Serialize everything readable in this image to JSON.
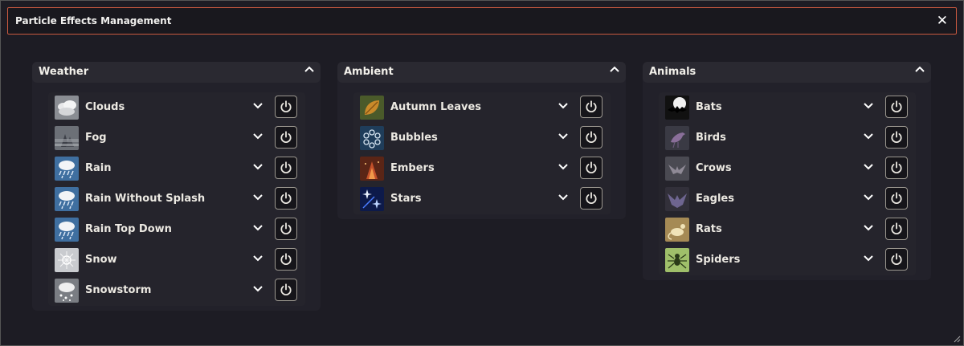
{
  "window": {
    "title": "Particle Effects Management",
    "close_glyph": "✕"
  },
  "panels": [
    {
      "title": "Weather",
      "items": [
        {
          "label": "Clouds",
          "icon": "cloud-icon"
        },
        {
          "label": "Fog",
          "icon": "fog-icon"
        },
        {
          "label": "Rain",
          "icon": "rain-icon"
        },
        {
          "label": "Rain Without Splash",
          "icon": "rain-icon"
        },
        {
          "label": "Rain Top Down",
          "icon": "rain-icon"
        },
        {
          "label": "Snow",
          "icon": "snow-icon"
        },
        {
          "label": "Snowstorm",
          "icon": "snowstorm-icon"
        }
      ]
    },
    {
      "title": "Ambient",
      "items": [
        {
          "label": "Autumn Leaves",
          "icon": "leaf-icon"
        },
        {
          "label": "Bubbles",
          "icon": "bubbles-icon"
        },
        {
          "label": "Embers",
          "icon": "embers-icon"
        },
        {
          "label": "Stars",
          "icon": "stars-icon"
        }
      ]
    },
    {
      "title": "Animals",
      "items": [
        {
          "label": "Bats",
          "icon": "bat-icon"
        },
        {
          "label": "Birds",
          "icon": "bird-icon"
        },
        {
          "label": "Crows",
          "icon": "crow-icon"
        },
        {
          "label": "Eagles",
          "icon": "eagle-icon"
        },
        {
          "label": "Rats",
          "icon": "rat-icon"
        },
        {
          "label": "Spiders",
          "icon": "spider-icon"
        }
      ]
    }
  ],
  "colors": {
    "window_border": "#c9593f",
    "background": "#1d1c24",
    "panel": "#22212a"
  }
}
